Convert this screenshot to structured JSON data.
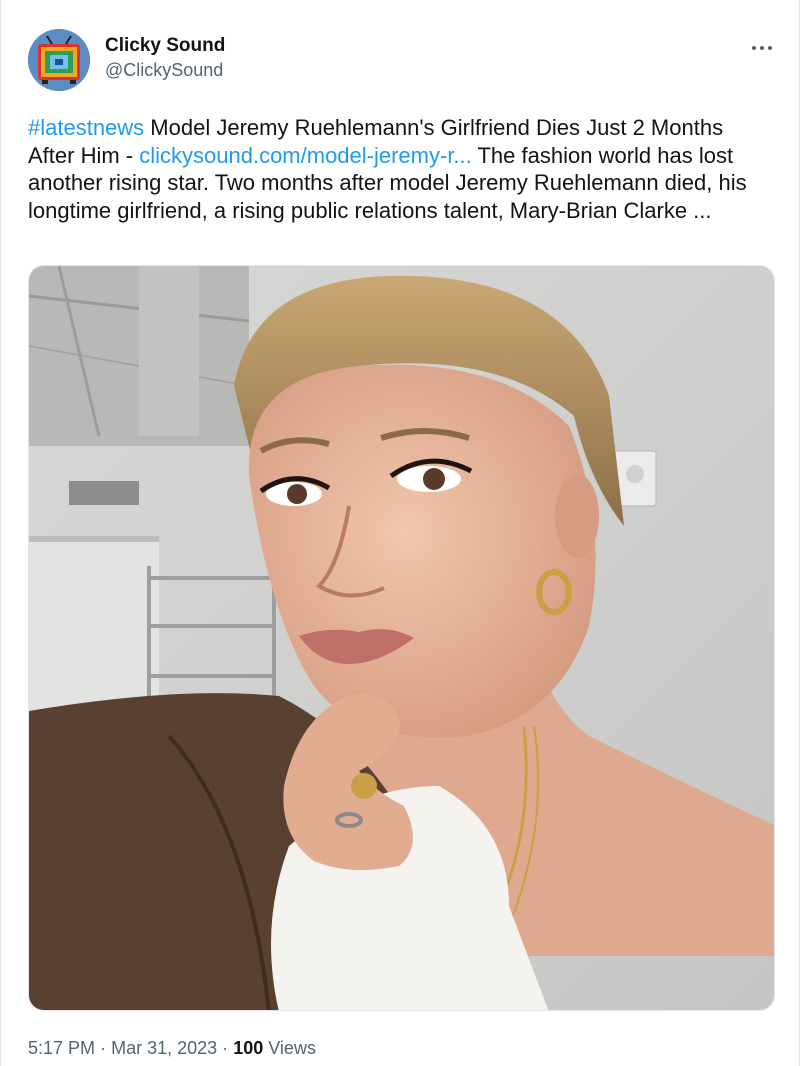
{
  "author": {
    "display_name": "Clicky Sound",
    "handle": "@ClickySound",
    "avatar_icon": "retro-tv-icon"
  },
  "tweet": {
    "hashtag": "#latestnews",
    "text_after_hashtag": " Model Jeremy Ruehlemann's Girlfriend Dies Just 2 Months After Him - ",
    "link": "clickysound.com/model-jeremy-r...",
    "text_after_link": "  The fashion world has lost another rising star. Two months after model Jeremy Ruehlemann died, his longtime girlfriend, a rising public relations talent, Mary-Brian Clarke ..."
  },
  "media": {
    "kind": "photo"
  },
  "meta": {
    "time": "5:17 PM",
    "separator": "·",
    "date": "Mar 31, 2023",
    "views_count": "100",
    "views_label": "Views"
  },
  "colors": {
    "link": "#1d9bf0",
    "secondary_text": "#536471",
    "primary_text": "#0f1419"
  }
}
